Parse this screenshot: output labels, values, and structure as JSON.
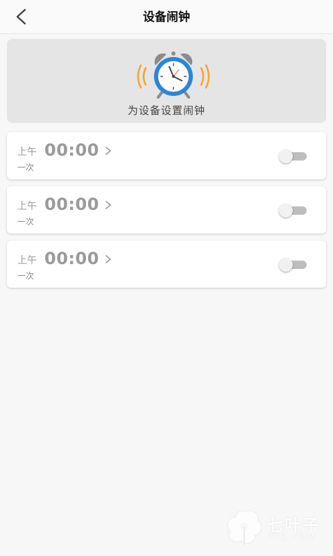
{
  "header": {
    "title": "设备闹钟",
    "back_icon": "chevron-left-icon"
  },
  "banner": {
    "icon": "alarm-clock-icon",
    "text": "为设备设置闹钟"
  },
  "alarms": [
    {
      "period": "上午",
      "time": "00:00",
      "repeat": "一次",
      "enabled": false
    },
    {
      "period": "上午",
      "time": "00:00",
      "repeat": "一次",
      "enabled": false
    },
    {
      "period": "上午",
      "time": "00:00",
      "repeat": "一次",
      "enabled": false
    }
  ],
  "watermark": {
    "name": "七叶子",
    "domain": "7YZ.COM"
  },
  "colors": {
    "background": "#f7f7f7",
    "banner_bg": "#e5e5e5",
    "clock_blue": "#2a86d9",
    "bell_gray": "#8c8c8c",
    "ring_orange": "#f3a531",
    "muted_text": "#9a9a9a",
    "toggle_off": "#bdbdbd"
  }
}
